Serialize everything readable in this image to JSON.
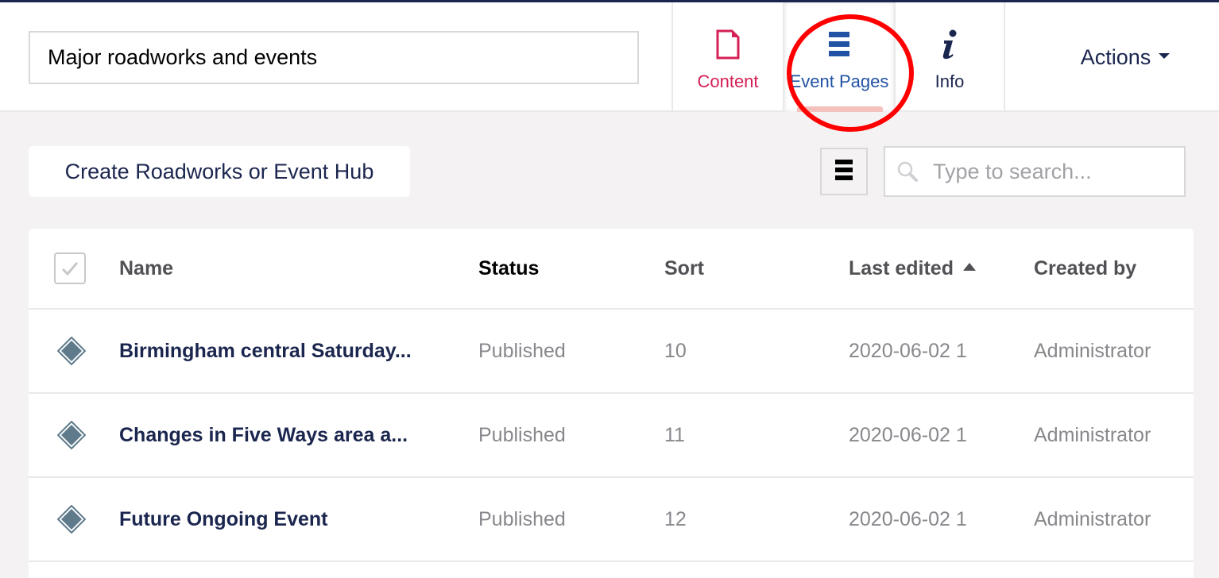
{
  "header": {
    "name_value": "Major roadworks and events",
    "tabs": [
      {
        "label": "Content",
        "icon": "document-icon",
        "color": "#d42054"
      },
      {
        "label": "Event Pages",
        "icon": "list-icon",
        "color": "#2152a3",
        "active": true
      },
      {
        "label": "Info",
        "icon": "info-icon",
        "color": "#1b264f"
      }
    ],
    "actions_label": "Actions"
  },
  "toolbar": {
    "create_label": "Create Roadworks or Event Hub",
    "search_placeholder": "Type to search..."
  },
  "table": {
    "columns": [
      "Name",
      "Status",
      "Sort",
      "Last edited",
      "Created by"
    ],
    "sorted_column": "Last edited",
    "sort_direction": "ascending",
    "rows": [
      {
        "name": "Birmingham central Saturday...",
        "status": "Published",
        "sort": "10",
        "last_edited": "2020-06-02 1",
        "created_by": "Administrator"
      },
      {
        "name": "Changes in Five Ways area a...",
        "status": "Published",
        "sort": "11",
        "last_edited": "2020-06-02 1",
        "created_by": "Administrator"
      },
      {
        "name": "Future Ongoing Event",
        "status": "Published",
        "sort": "12",
        "last_edited": "2020-06-02 1",
        "created_by": "Administrator"
      }
    ]
  },
  "colors": {
    "brand_navy": "#1b264f",
    "content_pink": "#d42054",
    "active_blue": "#2152a3",
    "highlight_red": "#ff0000"
  }
}
